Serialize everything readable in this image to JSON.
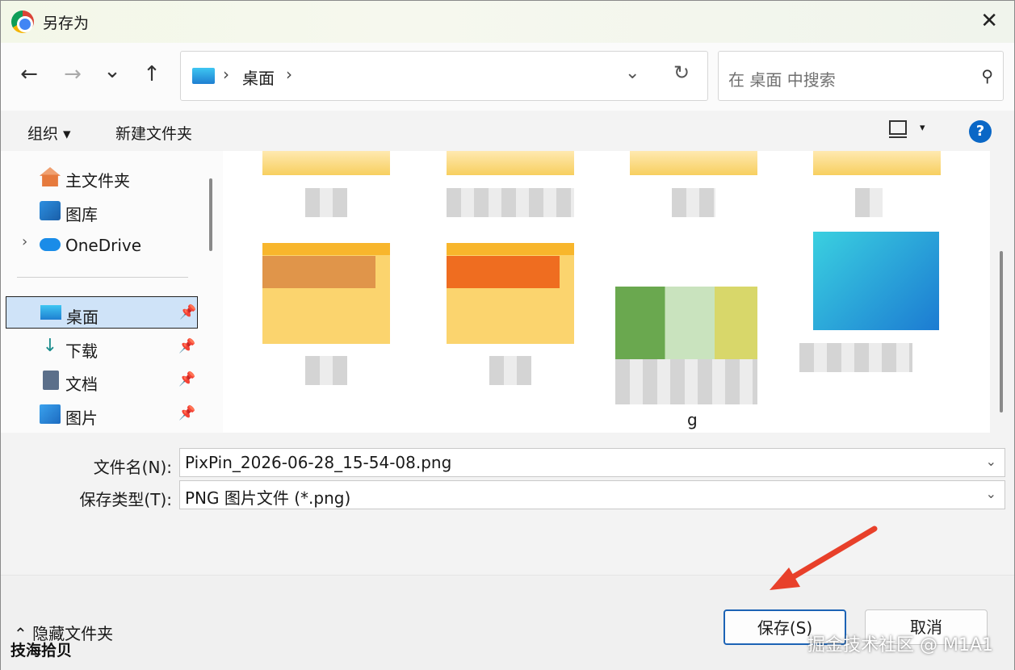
{
  "window": {
    "title": "另存为",
    "close_symbol": "✕"
  },
  "nav": {
    "back_symbol": "←",
    "forward_symbol": "→",
    "recent_symbol": "⌄",
    "up_symbol": "↑",
    "address": {
      "segment": "桌面",
      "separator": "›"
    },
    "dropdown_symbol": "⌄",
    "refresh_symbol": "↻",
    "search_placeholder": "在 桌面 中搜索",
    "search_symbol": "⚲"
  },
  "toolbar": {
    "organize_label": "组织 ▾",
    "newfolder_label": "新建文件夹",
    "view_arrow": "▾",
    "help_symbol": "?"
  },
  "sidebar": {
    "items": [
      {
        "label": "主文件夹",
        "icon": "home-icon"
      },
      {
        "label": "图库",
        "icon": "gallery-icon"
      },
      {
        "label": "OneDrive",
        "icon": "cloud-icon",
        "expand": "›"
      },
      {
        "label": "桌面",
        "icon": "desktop-icon",
        "pin": "📌"
      },
      {
        "label": "下载",
        "icon": "download-icon",
        "pin": "📌"
      },
      {
        "label": "文档",
        "icon": "document-icon",
        "pin": "📌"
      },
      {
        "label": "图片",
        "icon": "pictures-icon",
        "pin": "📌"
      }
    ]
  },
  "content": {
    "visible_file_label": "g"
  },
  "form": {
    "filename_label": "文件名(N):",
    "filename_value": "PixPin_2026-06-28_15-54-08.png",
    "filetype_label": "保存类型(T):",
    "filetype_value": "PNG 图片文件 (*.png)",
    "chevron": "⌄"
  },
  "footer": {
    "hide_folders_label": "⌃ 隐藏文件夹",
    "save_label": "保存(S)",
    "cancel_label": "取消",
    "watermark_right": "掘金技术社区 @ M1A1",
    "watermark_left": "技海拾贝"
  },
  "colors": {
    "accent": "#0a67c6",
    "selected_bg": "#cfe3f8",
    "arrow": "#e8402a"
  }
}
